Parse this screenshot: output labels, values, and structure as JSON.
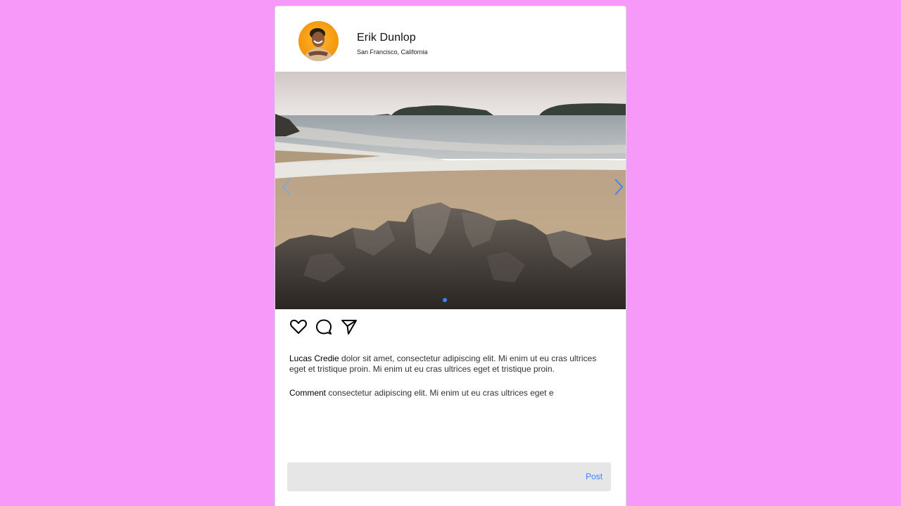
{
  "post": {
    "user": {
      "name": "Erik Dunlop",
      "location": "San Francisco, California"
    },
    "image": {
      "subject": "beach-with-rocks-photo",
      "carousel_slide": 1
    },
    "icons": {
      "like": "heart-icon",
      "comment": "comment-bubble-icon",
      "share": "send-icon",
      "prev": "chevron-left-icon",
      "next": "chevron-right-icon"
    },
    "caption": {
      "author": "Lucas Credie",
      "text": " dolor sit amet, consectetur adipiscing elit. Mi enim ut eu cras ultrices eget et tristique proin. Mi enim ut eu cras ultrices eget et tristique proin."
    },
    "comment": {
      "label": "Comment",
      "text": " consectetur adipiscing elit. Mi enim ut eu cras ultrices eget e"
    },
    "comment_box": {
      "placeholder": "",
      "post_label": "Post"
    }
  },
  "colors": {
    "background": "#f799f8",
    "accent": "#3b82f6",
    "avatar_bg": "#f59a10",
    "input_bg": "#e6e6e6"
  }
}
